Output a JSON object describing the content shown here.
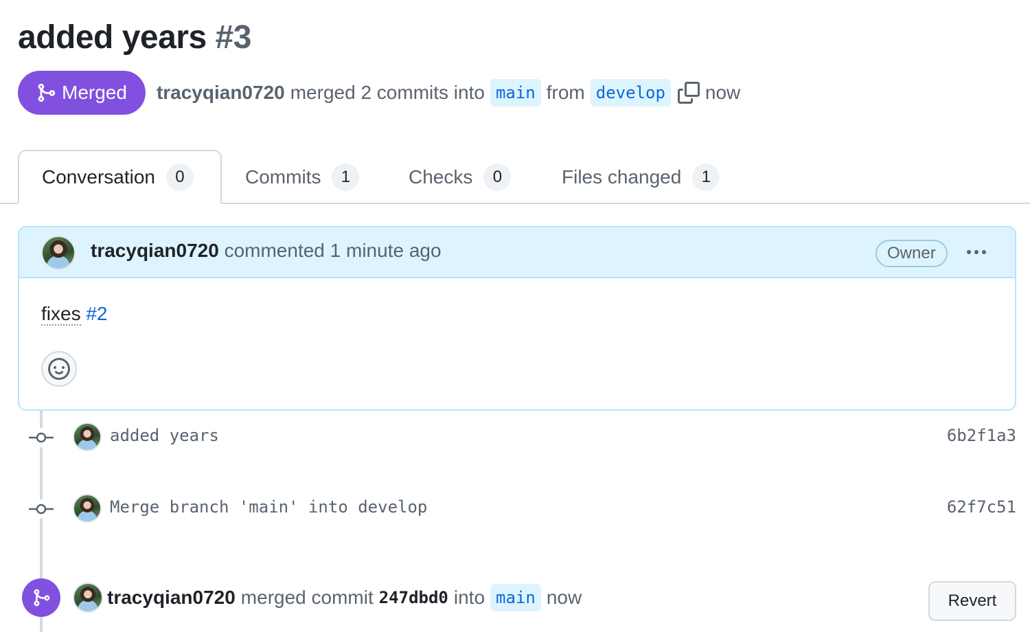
{
  "pr": {
    "title": "added years",
    "number": "#3"
  },
  "status": {
    "badge_label": "Merged",
    "author": "tracyqian0720",
    "merged_text": "merged 2 commits into",
    "base_branch": "main",
    "from_text": "from",
    "head_branch": "develop",
    "time": "now"
  },
  "tabs": [
    {
      "label": "Conversation",
      "count": "0"
    },
    {
      "label": "Commits",
      "count": "1"
    },
    {
      "label": "Checks",
      "count": "0"
    },
    {
      "label": "Files changed",
      "count": "1"
    }
  ],
  "comment": {
    "author": "tracyqian0720",
    "action": "commented 1 minute ago",
    "role_badge": "Owner",
    "body_text": "fixes",
    "body_link": "#2"
  },
  "commits": [
    {
      "message": "added years",
      "sha": "6b2f1a3"
    },
    {
      "message": "Merge branch 'main' into develop",
      "sha": "62f7c51"
    }
  ],
  "merge_event": {
    "author": "tracyqian0720",
    "text": "merged commit",
    "sha": "247dbd0",
    "into_text": "into",
    "branch": "main",
    "time": "now",
    "revert_label": "Revert"
  },
  "colors": {
    "merged_purple": "#8250df",
    "branch_bg": "#ddf4ff",
    "link_blue": "#0969da",
    "comment_header_bg": "#ddf4ff"
  },
  "icons": [
    "git-merge-icon",
    "copy-icon",
    "kebab-horizontal-icon",
    "smiley-icon",
    "git-commit-icon"
  ]
}
